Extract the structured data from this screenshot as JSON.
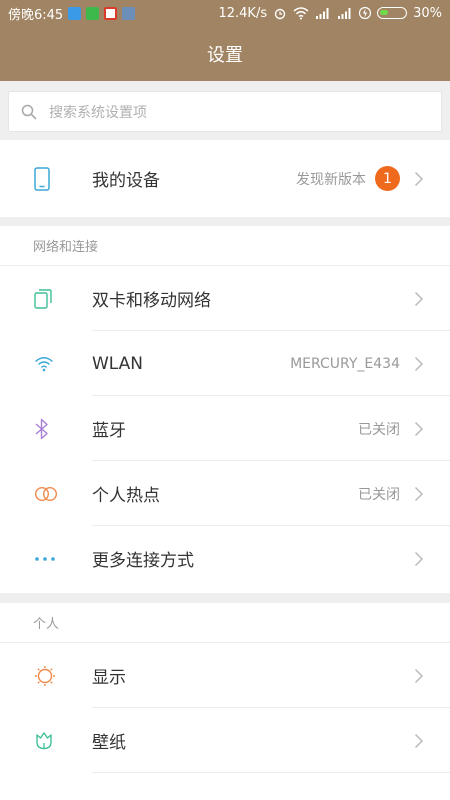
{
  "status_bar": {
    "time": "傍晚6:45",
    "speed": "12.4K/s",
    "battery": "30%",
    "battery_level": 0.3,
    "app_icons": [
      "upload-icon",
      "wechat-icon",
      "app-red-icon",
      "app-blue-icon"
    ]
  },
  "header": {
    "title": "设置"
  },
  "search": {
    "placeholder": "搜索系统设置项"
  },
  "device": {
    "label": "我的设备",
    "value": "发现新版本",
    "badge": "1"
  },
  "network": {
    "section_label": "网络和连接",
    "items": [
      {
        "label": "双卡和移动网络",
        "value": "",
        "icon": "sim-card-icon"
      },
      {
        "label": "WLAN",
        "value": "MERCURY_E434",
        "icon": "wifi-icon"
      },
      {
        "label": "蓝牙",
        "value": "已关闭",
        "icon": "bluetooth-icon"
      },
      {
        "label": "个人热点",
        "value": "已关闭",
        "icon": "hotspot-icon"
      },
      {
        "label": "更多连接方式",
        "value": "",
        "icon": "more-dots-icon"
      }
    ]
  },
  "personal": {
    "section_label": "个人",
    "items": [
      {
        "label": "显示",
        "value": "",
        "icon": "sun-icon"
      },
      {
        "label": "壁纸",
        "value": "",
        "icon": "tulip-icon"
      }
    ]
  },
  "colors": {
    "header_bg": "#a08463",
    "badge": "#f06a1e"
  }
}
